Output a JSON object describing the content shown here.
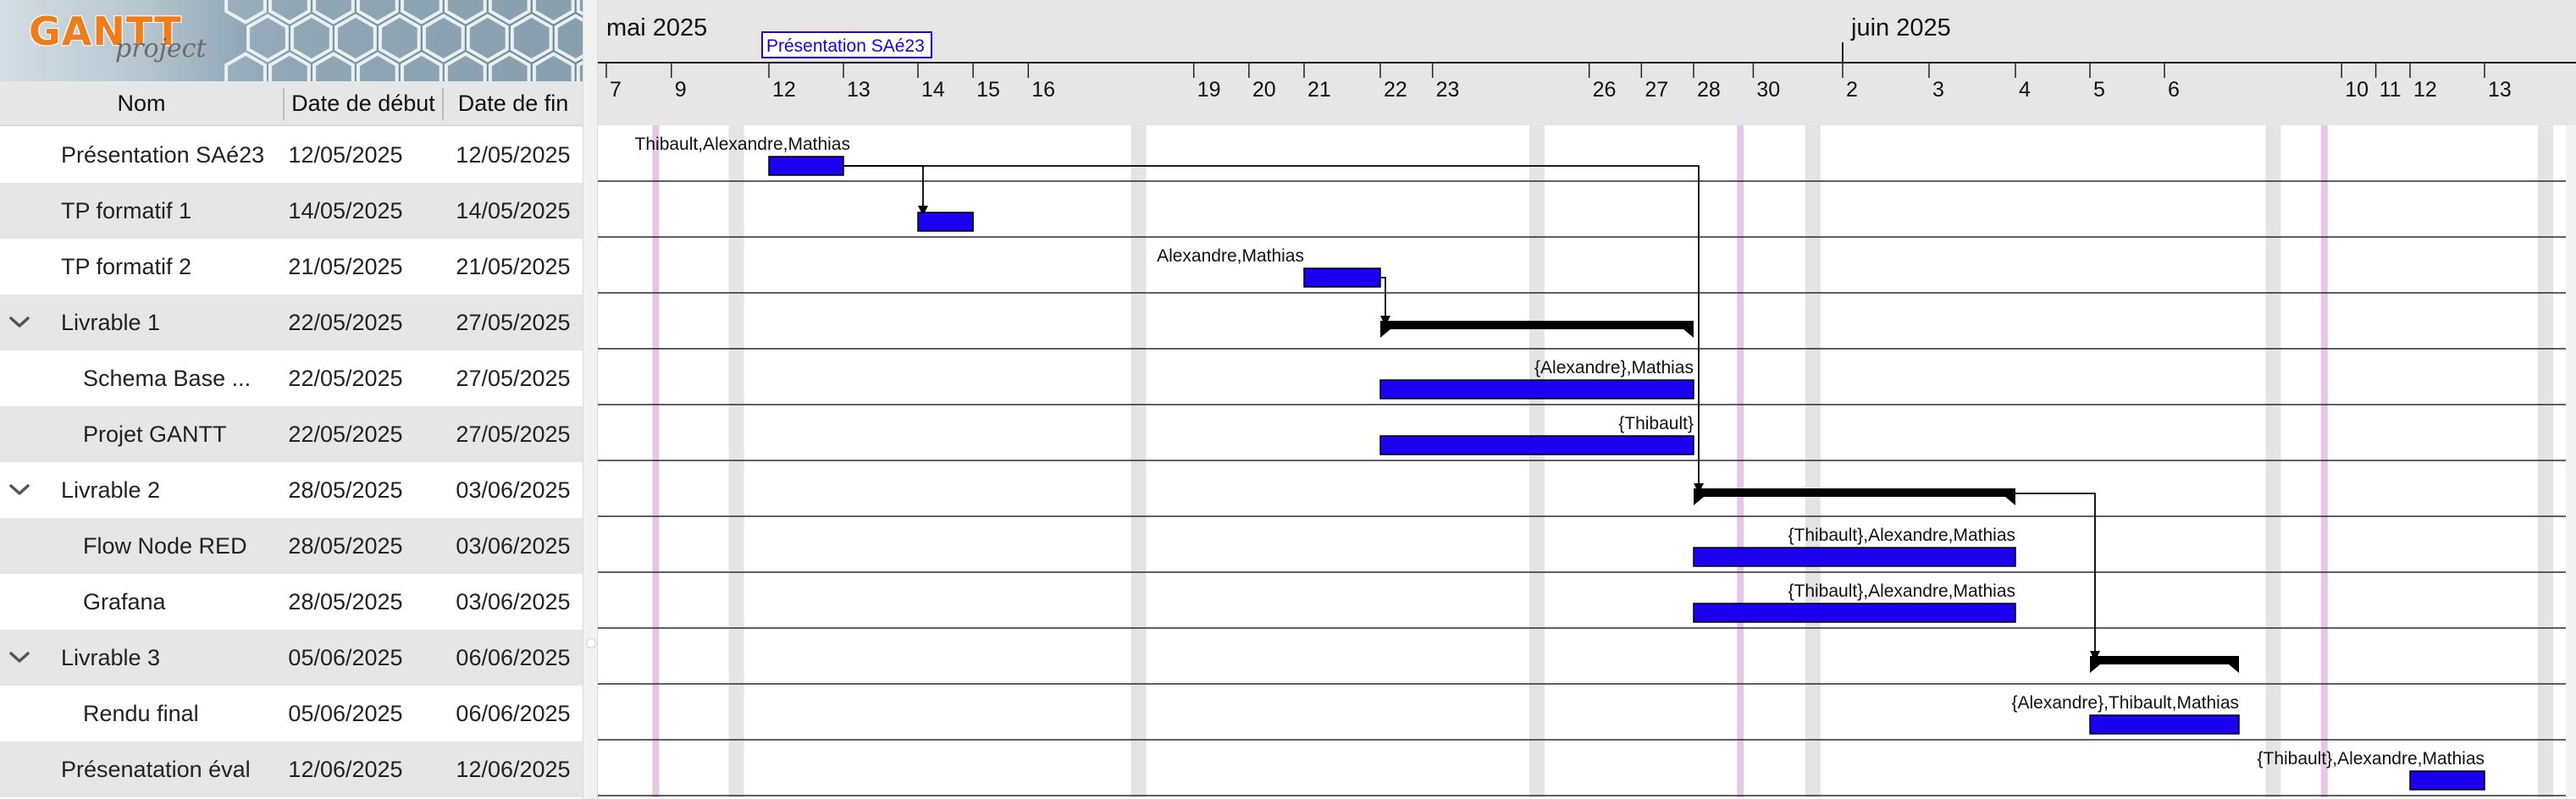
{
  "app": {
    "logo_text": "GANTT project"
  },
  "columns": {
    "name": "Nom",
    "start": "Date de début",
    "end": "Date de fin"
  },
  "tasks": [
    {
      "name": "Présentation SAé23",
      "start": "12/05/2025",
      "end": "12/05/2025",
      "level": 0,
      "type": "task",
      "bar_start": "2025-05-12",
      "bar_end": "2025-05-13",
      "label": "Thibault,Alexandre,Mathias",
      "label_side": "left"
    },
    {
      "name": "TP formatif 1",
      "start": "14/05/2025",
      "end": "14/05/2025",
      "level": 0,
      "type": "task",
      "bar_start": "2025-05-14",
      "bar_end": "2025-05-15",
      "label": "",
      "label_side": "right"
    },
    {
      "name": "TP formatif 2",
      "start": "21/05/2025",
      "end": "21/05/2025",
      "level": 0,
      "type": "task",
      "bar_start": "2025-05-21",
      "bar_end": "2025-05-22",
      "label": "Alexandre,Mathias",
      "label_side": "left"
    },
    {
      "name": "Livrable 1",
      "start": "22/05/2025",
      "end": "27/05/2025",
      "level": 0,
      "type": "group",
      "bar_start": "2025-05-22",
      "bar_end": "2025-05-28",
      "label": "",
      "label_side": "right"
    },
    {
      "name": "Schema Base ...",
      "start": "22/05/2025",
      "end": "27/05/2025",
      "level": 1,
      "type": "task",
      "bar_start": "2025-05-22",
      "bar_end": "2025-05-28",
      "label": "{Alexandre},Mathias",
      "label_side": "right"
    },
    {
      "name": "Projet GANTT",
      "start": "22/05/2025",
      "end": "27/05/2025",
      "level": 1,
      "type": "task",
      "bar_start": "2025-05-22",
      "bar_end": "2025-05-28",
      "label": "{Thibault}",
      "label_side": "right"
    },
    {
      "name": "Livrable 2",
      "start": "28/05/2025",
      "end": "03/06/2025",
      "level": 0,
      "type": "group",
      "bar_start": "2025-05-28",
      "bar_end": "2025-06-04",
      "label": "",
      "label_side": "right"
    },
    {
      "name": "Flow Node RED",
      "start": "28/05/2025",
      "end": "03/06/2025",
      "level": 1,
      "type": "task",
      "bar_start": "2025-05-28",
      "bar_end": "2025-06-04",
      "label": "{Thibault},Alexandre,Mathias",
      "label_side": "right"
    },
    {
      "name": "Grafana",
      "start": "28/05/2025",
      "end": "03/06/2025",
      "level": 1,
      "type": "task",
      "bar_start": "2025-05-28",
      "bar_end": "2025-06-04",
      "label": "{Thibault},Alexandre,Mathias",
      "label_side": "right"
    },
    {
      "name": "Livrable 3",
      "start": "05/06/2025",
      "end": "06/06/2025",
      "level": 0,
      "type": "group",
      "bar_start": "2025-06-05",
      "bar_end": "2025-06-07",
      "label": "",
      "label_side": "right"
    },
    {
      "name": "Rendu final",
      "start": "05/06/2025",
      "end": "06/06/2025",
      "level": 1,
      "type": "task",
      "bar_start": "2025-06-05",
      "bar_end": "2025-06-07",
      "label": "{Alexandre},Thibault,Mathias",
      "label_side": "right"
    },
    {
      "name": "Présenatation éval",
      "start": "12/06/2025",
      "end": "12/06/2025",
      "level": 0,
      "type": "task",
      "bar_start": "2025-06-12",
      "bar_end": "2025-06-13",
      "label": "{Thibault},Alexandre,Mathias",
      "label_side": "right"
    }
  ],
  "dependencies": [
    {
      "from": 0,
      "to": 1
    },
    {
      "from": 0,
      "to": 6
    },
    {
      "from": 2,
      "to": 3
    },
    {
      "from": 6,
      "to": 9
    }
  ],
  "timeline": {
    "months": [
      {
        "label": "mai 2025",
        "date": "2025-05-07"
      },
      {
        "label": "juin 2025",
        "date": "2025-06-02"
      }
    ],
    "day_ticks": [
      {
        "label": "7",
        "date": "2025-05-07"
      },
      {
        "label": "9",
        "date": "2025-05-09"
      },
      {
        "label": "12",
        "date": "2025-05-12"
      },
      {
        "label": "13",
        "date": "2025-05-13"
      },
      {
        "label": "14",
        "date": "2025-05-14"
      },
      {
        "label": "15",
        "date": "2025-05-15"
      },
      {
        "label": "16",
        "date": "2025-05-16"
      },
      {
        "label": "19",
        "date": "2025-05-19"
      },
      {
        "label": "20",
        "date": "2025-05-20"
      },
      {
        "label": "21",
        "date": "2025-05-21"
      },
      {
        "label": "22",
        "date": "2025-05-22"
      },
      {
        "label": "23",
        "date": "2025-05-23"
      },
      {
        "label": "26",
        "date": "2025-05-26"
      },
      {
        "label": "27",
        "date": "2025-05-27"
      },
      {
        "label": "28",
        "date": "2025-05-28"
      },
      {
        "label": "30",
        "date": "2025-05-30"
      },
      {
        "label": "2",
        "date": "2025-06-02"
      },
      {
        "label": "3",
        "date": "2025-06-03"
      },
      {
        "label": "4",
        "date": "2025-06-04"
      },
      {
        "label": "5",
        "date": "2025-06-05"
      },
      {
        "label": "6",
        "date": "2025-06-06"
      },
      {
        "label": "10",
        "date": "2025-06-10"
      },
      {
        "label": "11",
        "date": "2025-06-11"
      },
      {
        "label": "12",
        "date": "2025-06-12"
      },
      {
        "label": "13",
        "date": "2025-06-13"
      }
    ],
    "milestone_label": {
      "text": "Présentation SAé23",
      "date": "2025-05-12"
    },
    "weekend_dates": [
      "2025-05-11",
      "2025-05-18",
      "2025-05-25",
      "2025-06-01",
      "2025-06-08",
      "2025-06-15"
    ],
    "holiday_dates": [
      "2025-05-08",
      "2025-05-29",
      "2025-06-09"
    ]
  },
  "colors": {
    "task_bar": "#1a00ee",
    "group_bar": "#000000",
    "holiday": "#e6c8e6",
    "weekend": "#e4e4e4",
    "alt_row": "#e6e6e6"
  }
}
